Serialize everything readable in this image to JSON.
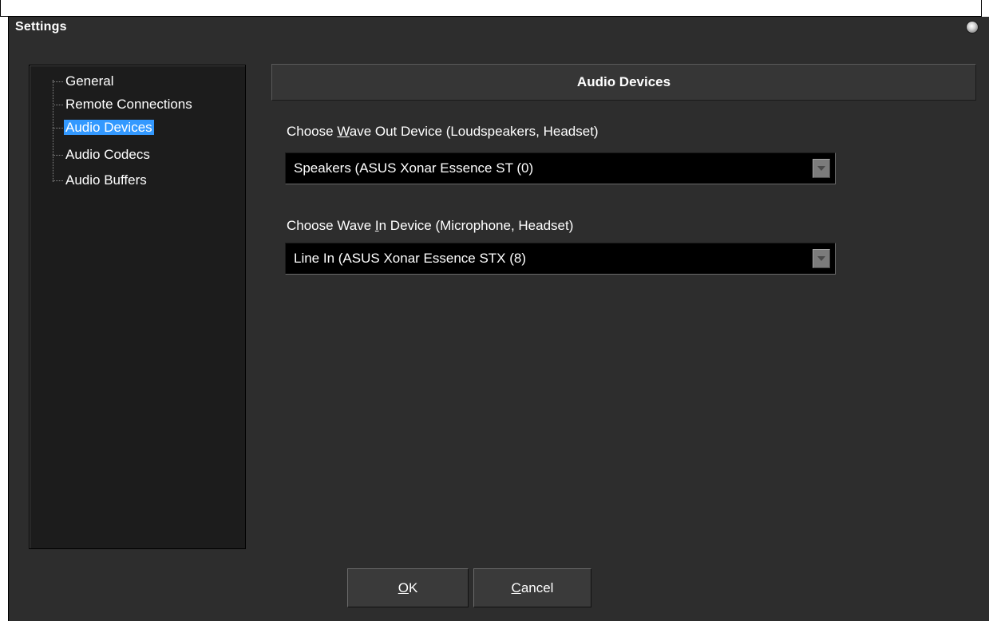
{
  "window": {
    "title": "Settings"
  },
  "tree": {
    "items": [
      {
        "label": "General",
        "selected": false
      },
      {
        "label": "Remote Connections",
        "selected": false
      },
      {
        "label": "Audio Devices",
        "selected": true
      },
      {
        "label": "Audio Codecs",
        "selected": false
      },
      {
        "label": "Audio Buffers",
        "selected": false
      }
    ]
  },
  "panel": {
    "header": "Audio Devices",
    "wave_out": {
      "label_pre": "Choose ",
      "label_accel": "W",
      "label_post": "ave Out Device (Loudspeakers, Headset)",
      "value": "Speakers (ASUS Xonar Essence ST (0)"
    },
    "wave_in": {
      "label_pre": "Choose Wave ",
      "label_accel": "I",
      "label_post": "n Device (Microphone, Headset)",
      "value": "Line In (ASUS Xonar Essence STX (8)"
    }
  },
  "buttons": {
    "ok_accel": "O",
    "ok_rest": "K",
    "cancel_accel": "C",
    "cancel_rest": "ancel"
  },
  "colors": {
    "window_bg": "#2d2d2d",
    "selection": "#3399ff",
    "combo_bg": "#000000"
  }
}
